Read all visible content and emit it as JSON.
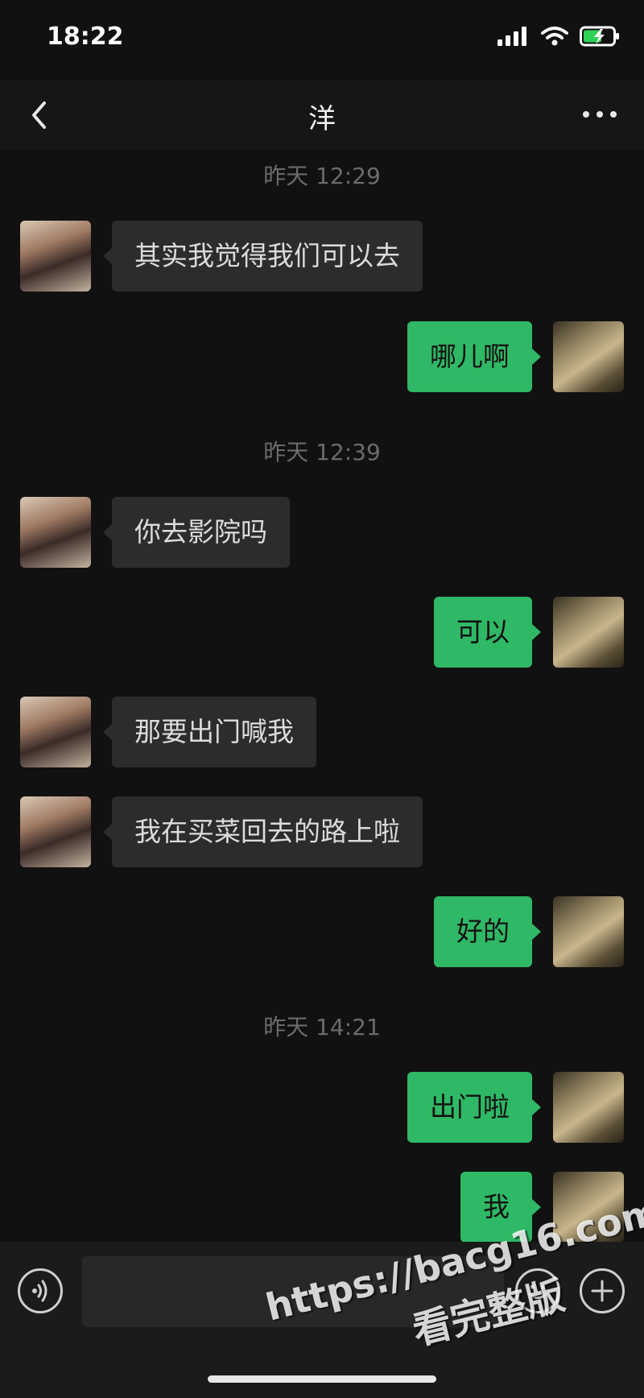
{
  "status_bar": {
    "time": "18:22"
  },
  "header": {
    "title": "洋"
  },
  "messages": [
    {
      "timestamp": "昨天 12:29"
    },
    {
      "side": "left",
      "text": "其实我觉得我们可以去"
    },
    {
      "side": "right",
      "text": "哪儿啊"
    },
    {
      "timestamp": "昨天 12:39"
    },
    {
      "side": "left",
      "text": "你去影院吗"
    },
    {
      "side": "right",
      "text": "可以"
    },
    {
      "side": "left",
      "text": "那要出门喊我"
    },
    {
      "side": "left",
      "text": "我在买菜回去的路上啦"
    },
    {
      "side": "right",
      "text": "好的"
    },
    {
      "timestamp": "昨天 14:21"
    },
    {
      "side": "right",
      "text": "出门啦"
    },
    {
      "side": "right",
      "text": "我"
    }
  ],
  "watermark": {
    "line1": "https://bacg16.com",
    "line2": "看完整版"
  },
  "colors": {
    "background": "#111111",
    "bubble_incoming": "#2c2c2c",
    "bubble_outgoing": "#2fb865"
  }
}
